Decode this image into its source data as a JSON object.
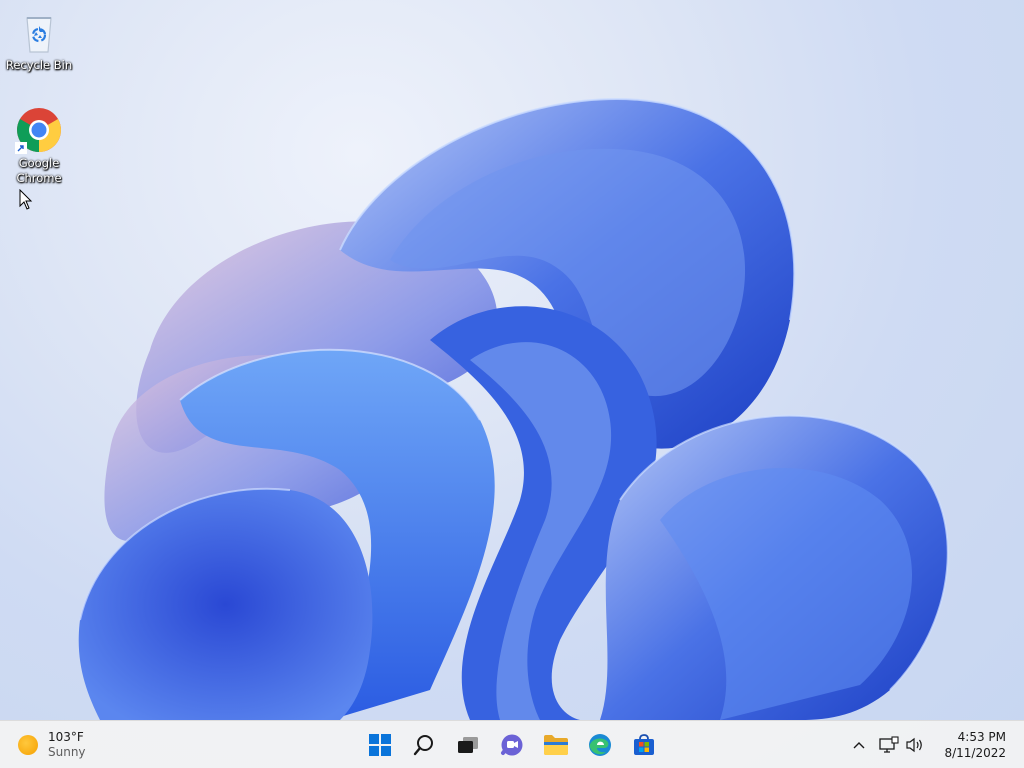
{
  "desktop": {
    "icons": [
      {
        "label": "Recycle Bin",
        "icon": "recycle-bin-icon"
      },
      {
        "label": "Google Chrome",
        "icon": "chrome-icon"
      }
    ]
  },
  "taskbar": {
    "weather": {
      "temperature": "103°F",
      "condition": "Sunny",
      "icon": "sun-icon"
    },
    "pinned": [
      {
        "name": "Start",
        "icon": "windows-start-icon"
      },
      {
        "name": "Search",
        "icon": "search-icon"
      },
      {
        "name": "Task View",
        "icon": "task-view-icon"
      },
      {
        "name": "Chat",
        "icon": "teams-chat-icon"
      },
      {
        "name": "File Explorer",
        "icon": "folder-icon"
      },
      {
        "name": "Microsoft Edge",
        "icon": "edge-icon"
      },
      {
        "name": "Microsoft Store",
        "icon": "store-icon"
      }
    ],
    "tray": {
      "time": "4:53 PM",
      "date": "8/11/2022",
      "icons": [
        "chevron-up-icon",
        "network-icon",
        "volume-icon"
      ]
    }
  },
  "colors": {
    "accent": "#0067c0",
    "taskbar_bg": "#f3f3f3",
    "bloom_blue": "#2f5fe0",
    "bloom_light": "#8fb2f7"
  }
}
